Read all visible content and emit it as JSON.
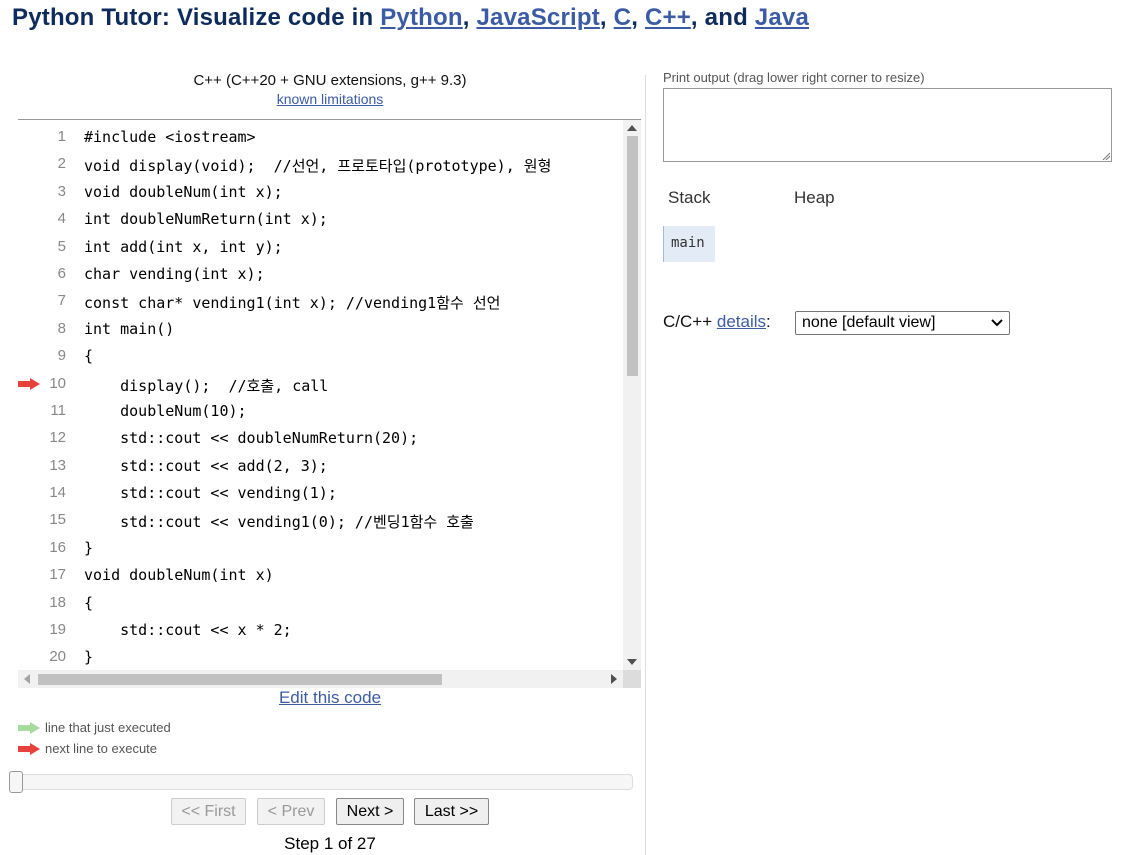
{
  "header": {
    "prefix": "Python Tutor: Visualize code in ",
    "langs": [
      "Python",
      "JavaScript",
      "C",
      "C++",
      "Java"
    ],
    "sep1": ", ",
    "sep2": ", ",
    "sep3": ", ",
    "sep4": ", and "
  },
  "editor": {
    "language_label": "C++ (C++20 + GNU extensions, g++ 9.3)",
    "limitations_link": "known limitations",
    "current_line": 10,
    "lines": [
      {
        "n": "1",
        "text": "#include <iostream>"
      },
      {
        "n": "2",
        "text": "void display(void);  //선언, 프로토타입(prototype), 원형"
      },
      {
        "n": "3",
        "text": "void doubleNum(int x);"
      },
      {
        "n": "4",
        "text": "int doubleNumReturn(int x);"
      },
      {
        "n": "5",
        "text": "int add(int x, int y);"
      },
      {
        "n": "6",
        "text": "char vending(int x);"
      },
      {
        "n": "7",
        "text": "const char* vending1(int x); //vending1함수 선언"
      },
      {
        "n": "8",
        "text": "int main()"
      },
      {
        "n": "9",
        "text": "{"
      },
      {
        "n": "10",
        "text": "    display();  //호출, call"
      },
      {
        "n": "11",
        "text": "    doubleNum(10);"
      },
      {
        "n": "12",
        "text": "    std::cout << doubleNumReturn(20);"
      },
      {
        "n": "13",
        "text": "    std::cout << add(2, 3);"
      },
      {
        "n": "14",
        "text": "    std::cout << vending(1);"
      },
      {
        "n": "15",
        "text": "    std::cout << vending1(0); //벤딩1함수 호출"
      },
      {
        "n": "16",
        "text": "}"
      },
      {
        "n": "17",
        "text": "void doubleNum(int x)"
      },
      {
        "n": "18",
        "text": "{"
      },
      {
        "n": "19",
        "text": "    std::cout << x * 2;"
      },
      {
        "n": "20",
        "text": "}"
      }
    ],
    "edit_link": "Edit this code"
  },
  "legend": {
    "executed": "line that just executed",
    "next": "next line to execute",
    "executed_color": "#a6dba0",
    "next_color": "#e8413b"
  },
  "nav": {
    "first": "<< First",
    "prev": "< Prev",
    "next": "Next >",
    "last": "Last >>",
    "step_text": "Step 1 of 27",
    "progress": 0
  },
  "output": {
    "label": "Print output (drag lower right corner to resize)",
    "content": ""
  },
  "viz": {
    "stack_header": "Stack",
    "heap_header": "Heap",
    "frames": [
      "main"
    ]
  },
  "details": {
    "prefix": "C/C++ ",
    "link": "details",
    "suffix": ":",
    "selected": "none [default view]"
  }
}
